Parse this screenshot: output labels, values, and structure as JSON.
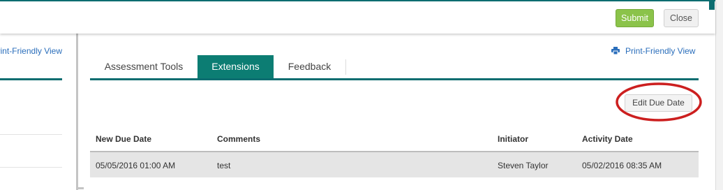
{
  "toolbar": {
    "submit_label": "Submit",
    "close_label": "Close"
  },
  "left_panel": {
    "print_link": "Print-Friendly View"
  },
  "main": {
    "print_link": "Print-Friendly View",
    "tabs": [
      {
        "label": "Assessment Tools",
        "active": false
      },
      {
        "label": "Extensions",
        "active": true
      },
      {
        "label": "Feedback",
        "active": false
      }
    ],
    "edit_due_date_label": "Edit Due Date",
    "table": {
      "columns": [
        "New Due Date",
        "Comments",
        "Initiator",
        "Activity Date"
      ],
      "rows": [
        [
          "05/05/2016 01:00 AM",
          "test",
          "Steven Taylor",
          "05/02/2016 08:35 AM"
        ]
      ]
    }
  },
  "colors": {
    "accent": "#0c7d73",
    "submit": "#8bc34a",
    "link": "#2a6ebb",
    "annotation": "#cc1f1f"
  },
  "icons": {
    "print": "printer-icon"
  }
}
